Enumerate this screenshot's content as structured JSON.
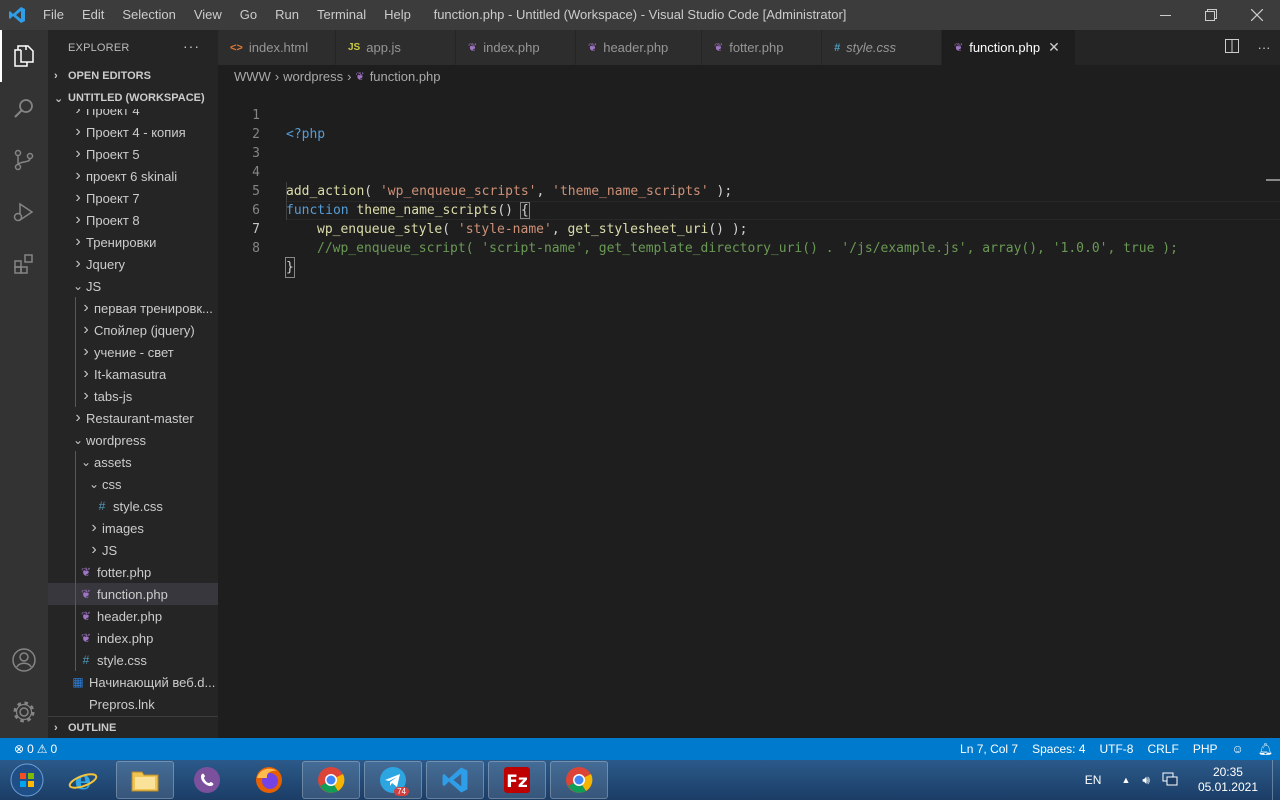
{
  "window": {
    "title": "function.php - Untitled (Workspace) - Visual Studio Code [Administrator]",
    "menu": [
      "File",
      "Edit",
      "Selection",
      "View",
      "Go",
      "Run",
      "Terminal",
      "Help"
    ]
  },
  "sidebar": {
    "title": "EXPLORER",
    "sections": {
      "open_editors": "OPEN EDITORS",
      "workspace": "UNTITLED (WORKSPACE)",
      "outline": "OUTLINE"
    },
    "tree": [
      {
        "label": "Проект 4",
        "type": "folder"
      },
      {
        "label": "Проект 4 - копия",
        "type": "folder"
      },
      {
        "label": "Проект 5",
        "type": "folder"
      },
      {
        "label": "проект 6 skinali",
        "type": "folder"
      },
      {
        "label": "Проект 7",
        "type": "folder"
      },
      {
        "label": "Проект 8",
        "type": "folder"
      },
      {
        "label": "Тренировки",
        "type": "folder"
      },
      {
        "label": "Jquery",
        "type": "folder"
      },
      {
        "label": "JS",
        "type": "folder-open"
      },
      {
        "label": "первая тренировк...",
        "type": "folder"
      },
      {
        "label": "Спойлер (jquery)",
        "type": "folder"
      },
      {
        "label": "учение - свет",
        "type": "folder"
      },
      {
        "label": "It-kamasutra",
        "type": "folder"
      },
      {
        "label": "tabs-js",
        "type": "folder"
      },
      {
        "label": "Restaurant-master",
        "type": "folder"
      },
      {
        "label": "wordpress",
        "type": "folder-open"
      },
      {
        "label": "assets",
        "type": "folder-open"
      },
      {
        "label": "css",
        "type": "folder-open"
      },
      {
        "label": "style.css",
        "type": "css"
      },
      {
        "label": "images",
        "type": "folder"
      },
      {
        "label": "JS",
        "type": "folder"
      },
      {
        "label": "fotter.php",
        "type": "php"
      },
      {
        "label": "function.php",
        "type": "php"
      },
      {
        "label": "header.php",
        "type": "php"
      },
      {
        "label": "index.php",
        "type": "php"
      },
      {
        "label": "style.css",
        "type": "css"
      },
      {
        "label": "Начинающий веб.d...",
        "type": "doc"
      },
      {
        "label": "Prepros.lnk",
        "type": "plain"
      }
    ]
  },
  "tabs": [
    {
      "label": "index.html",
      "type": "html"
    },
    {
      "label": "app.js",
      "type": "js"
    },
    {
      "label": "index.php",
      "type": "php"
    },
    {
      "label": "header.php",
      "type": "php"
    },
    {
      "label": "fotter.php",
      "type": "php"
    },
    {
      "label": "style.css",
      "type": "css"
    },
    {
      "label": "function.php",
      "type": "php"
    }
  ],
  "breadcrumb": [
    "WWW",
    "wordpress",
    "function.php"
  ],
  "editor": {
    "line_numbers": [
      "1",
      "2",
      "3",
      "4",
      "5",
      "6",
      "7",
      "8"
    ],
    "code": {
      "l1": "<?php",
      "l4_fn": "add_action",
      "l4_a": "( ",
      "l4_s1": "'wp_enqueue_scripts'",
      "l4_b": ", ",
      "l4_s2": "'theme_name_scripts'",
      "l4_c": " );",
      "l5_kw": "function",
      "l5_fn": "theme_name_scripts",
      "l5_a": "() ",
      "l5_brace": "{",
      "l6_fn": "wp_enqueue_style",
      "l6_a": "( ",
      "l6_s1": "'style-name'",
      "l6_b": ", ",
      "l6_fn2": "get_stylesheet_uri",
      "l6_c": "() );",
      "l7_cm": "//wp_enqueue_script( 'script-name', get_template_directory_uri() . '/js/example.js', array(), '1.0.0', true );",
      "l8_brace": "}"
    }
  },
  "status": {
    "errors": "0",
    "warnings": "0",
    "position": "Ln 7, Col 7",
    "spaces": "Spaces: 4",
    "encoding": "UTF-8",
    "eol": "CRLF",
    "language": "PHP"
  },
  "taskbar": {
    "lang": "EN",
    "time": "20:35",
    "date": "05.01.2021",
    "telegram_badge": "74"
  },
  "colors": {
    "accent": "#007acc",
    "php_icon": "#a074c4",
    "css_icon": "#519aba",
    "js_icon": "#cbcb41",
    "html_icon": "#e37933"
  }
}
